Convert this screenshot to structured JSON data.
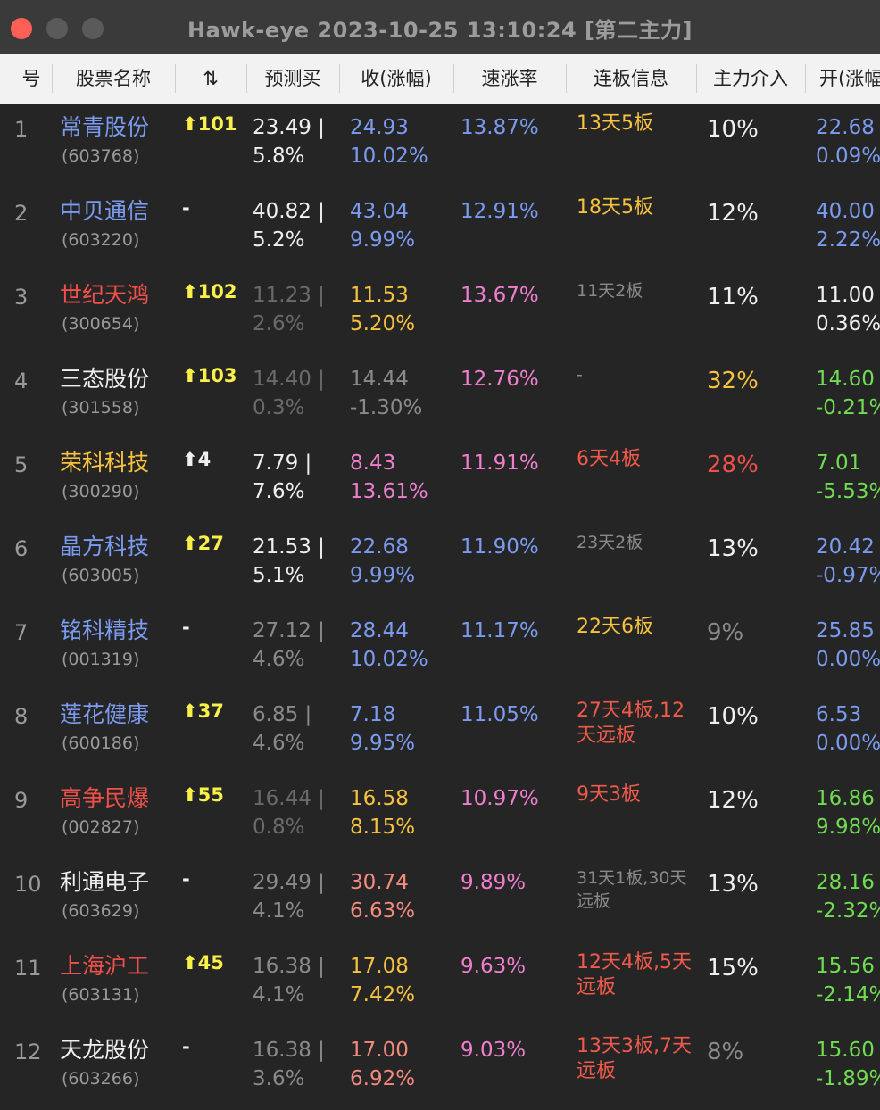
{
  "window": {
    "title": "Hawk-eye 2023-10-25 13:10:24 [第二主力]"
  },
  "colors": {
    "blue": "#7a9bf0",
    "red": "#f0504a",
    "yellow": "#f7c23e",
    "white": "#f0f0f0",
    "gray": "#8a8a8a",
    "dim": "#6a6a6a",
    "pink": "#f07fcf",
    "green": "#6fdc52",
    "orange_red": "#ef5a4a",
    "salmon": "#f28a7d",
    "rank_yellow": "#f9f04a"
  },
  "header": {
    "cols": [
      "号",
      "股票名称",
      "⇅",
      "预测买",
      "收(涨幅)",
      "速涨率",
      "连板信息",
      "主力介入",
      "开(涨幅"
    ]
  },
  "rows": [
    {
      "idx": "1",
      "name": "常青股份",
      "code": "(603768)",
      "rank": "⬆101",
      "pred1": "23.49 |",
      "pred2": "5.8%",
      "close1": "24.93",
      "close2": "10.02%",
      "speed": "13.87%",
      "board": "13天5板",
      "main": "10%",
      "open1": "22.68",
      "open2": "0.09%"
    },
    {
      "idx": "2",
      "name": "中贝通信",
      "code": "(603220)",
      "rank": "-",
      "pred1": "40.82 |",
      "pred2": "5.2%",
      "close1": "43.04",
      "close2": "9.99%",
      "speed": "12.91%",
      "board": "18天5板",
      "main": "12%",
      "open1": "40.00",
      "open2": "2.22%"
    },
    {
      "idx": "3",
      "name": "世纪天鸿",
      "code": "(300654)",
      "rank": "⬆102",
      "pred1": "11.23 |",
      "pred2": "2.6%",
      "close1": "11.53",
      "close2": "5.20%",
      "speed": "13.67%",
      "board": "11天2板",
      "main": "11%",
      "open1": "11.00",
      "open2": "0.36%"
    },
    {
      "idx": "4",
      "name": "三态股份",
      "code": "(301558)",
      "rank": "⬆103",
      "pred1": "14.40 |",
      "pred2": "0.3%",
      "close1": "14.44",
      "close2": "-1.30%",
      "speed": "12.76%",
      "board": "-",
      "main": "32%",
      "open1": "14.60",
      "open2": "-0.21%"
    },
    {
      "idx": "5",
      "name": "荣科科技",
      "code": "(300290)",
      "rank": "⬆4",
      "pred1": "7.79 |",
      "pred2": "7.6%",
      "close1": "8.43",
      "close2": "13.61%",
      "speed": "11.91%",
      "board": "6天4板",
      "main": "28%",
      "open1": "7.01",
      "open2": "-5.53%"
    },
    {
      "idx": "6",
      "name": "晶方科技",
      "code": "(603005)",
      "rank": "⬆27",
      "pred1": "21.53 |",
      "pred2": "5.1%",
      "close1": "22.68",
      "close2": "9.99%",
      "speed": "11.90%",
      "board": "23天2板",
      "main": "13%",
      "open1": "20.42",
      "open2": "-0.97%"
    },
    {
      "idx": "7",
      "name": "铭科精技",
      "code": "(001319)",
      "rank": "-",
      "pred1": "27.12 |",
      "pred2": "4.6%",
      "close1": "28.44",
      "close2": "10.02%",
      "speed": "11.17%",
      "board": "22天6板",
      "main": "9%",
      "open1": "25.85",
      "open2": "0.00%"
    },
    {
      "idx": "8",
      "name": "莲花健康",
      "code": "(600186)",
      "rank": "⬆37",
      "pred1": "6.85 |",
      "pred2": "4.6%",
      "close1": "7.18",
      "close2": "9.95%",
      "speed": "11.05%",
      "board": "27天4板,12天远板",
      "main": "10%",
      "open1": "6.53",
      "open2": "0.00%"
    },
    {
      "idx": "9",
      "name": "高争民爆",
      "code": "(002827)",
      "rank": "⬆55",
      "pred1": "16.44 |",
      "pred2": "0.8%",
      "close1": "16.58",
      "close2": "8.15%",
      "speed": "10.97%",
      "board": "9天3板",
      "main": "12%",
      "open1": "16.86",
      "open2": "9.98%"
    },
    {
      "idx": "10",
      "name": "利通电子",
      "code": "(603629)",
      "rank": "-",
      "pred1": "29.49 |",
      "pred2": "4.1%",
      "close1": "30.74",
      "close2": "6.63%",
      "speed": "9.89%",
      "board": "31天1板,30天远板",
      "main": "13%",
      "open1": "28.16",
      "open2": "-2.32%"
    },
    {
      "idx": "11",
      "name": "上海沪工",
      "code": "(603131)",
      "rank": "⬆45",
      "pred1": "16.38 |",
      "pred2": "4.1%",
      "close1": "17.08",
      "close2": "7.42%",
      "speed": "9.63%",
      "board": "12天4板,5天远板",
      "main": "15%",
      "open1": "15.56",
      "open2": "-2.14%"
    },
    {
      "idx": "12",
      "name": "天龙股份",
      "code": "(603266)",
      "rank": "-",
      "pred1": "16.38 |",
      "pred2": "3.6%",
      "close1": "17.00",
      "close2": "6.92%",
      "speed": "9.03%",
      "board": "13天3板,7天远板",
      "main": "8%",
      "open1": "15.60",
      "open2": "-1.89%"
    }
  ],
  "row_colors": [
    {
      "name": "blue",
      "rank": "rank_yellow",
      "pred": "white",
      "close": "blue",
      "speed": "blue",
      "board": "yellow",
      "main": "white",
      "open": "blue",
      "board_small": false
    },
    {
      "name": "blue",
      "rank": "white",
      "pred": "white",
      "close": "blue",
      "speed": "blue",
      "board": "yellow",
      "main": "white",
      "open": "blue",
      "board_small": false
    },
    {
      "name": "red",
      "rank": "rank_yellow",
      "pred": "dim",
      "close": "yellow",
      "speed": "pink",
      "board": "gray",
      "main": "white",
      "open": "white",
      "board_small": true
    },
    {
      "name": "white",
      "rank": "rank_yellow",
      "pred": "dim",
      "close": "gray",
      "speed": "pink",
      "board": "gray",
      "main": "yellow",
      "open": "green",
      "board_small": true
    },
    {
      "name": "yellow",
      "rank": "white",
      "pred": "white",
      "close": "pink",
      "speed": "pink",
      "board": "orange_red",
      "main": "red",
      "open": "green",
      "board_small": false
    },
    {
      "name": "blue",
      "rank": "rank_yellow",
      "pred": "white",
      "close": "blue",
      "speed": "blue",
      "board": "gray",
      "main": "white",
      "open": "blue",
      "board_small": true
    },
    {
      "name": "blue",
      "rank": "white",
      "pred": "gray",
      "close": "blue",
      "speed": "blue",
      "board": "yellow",
      "main": "gray",
      "open": "blue",
      "board_small": false
    },
    {
      "name": "blue",
      "rank": "rank_yellow",
      "pred": "gray",
      "close": "blue",
      "speed": "blue",
      "board": "orange_red",
      "main": "white",
      "open": "blue",
      "board_small": false
    },
    {
      "name": "red",
      "rank": "rank_yellow",
      "pred": "dim",
      "close": "yellow",
      "speed": "pink",
      "board": "orange_red",
      "main": "white",
      "open": "green",
      "board_small": false
    },
    {
      "name": "white",
      "rank": "white",
      "pred": "gray",
      "close": "salmon",
      "speed": "pink",
      "board": "gray",
      "main": "white",
      "open": "green",
      "board_small": true
    },
    {
      "name": "red",
      "rank": "rank_yellow",
      "pred": "gray",
      "close": "yellow",
      "speed": "pink",
      "board": "orange_red",
      "main": "white",
      "open": "green",
      "board_small": false
    },
    {
      "name": "white",
      "rank": "white",
      "pred": "gray",
      "close": "salmon",
      "speed": "pink",
      "board": "orange_red",
      "main": "gray",
      "open": "green",
      "board_small": false
    }
  ]
}
